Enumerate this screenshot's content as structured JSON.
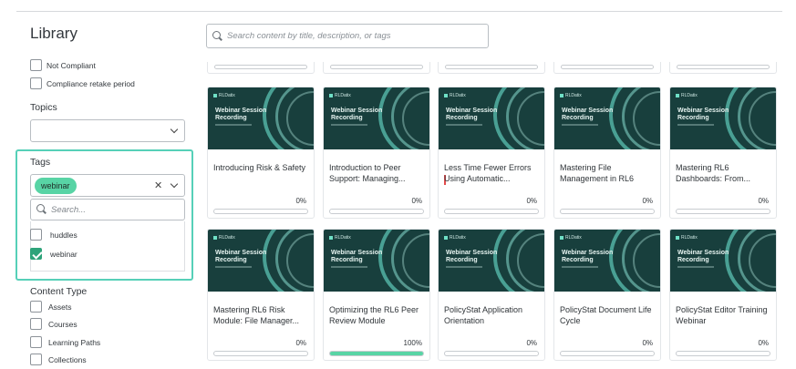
{
  "library": {
    "title": "Library"
  },
  "search": {
    "placeholder": "Search content by title, description, or tags"
  },
  "compliance": [
    {
      "label": "Not Compliant",
      "checked": false
    },
    {
      "label": "Compliance retake period",
      "checked": false
    }
  ],
  "topics": {
    "label": "Topics",
    "value": ""
  },
  "tags": {
    "label": "Tags",
    "selected_chip": "webinar",
    "search_placeholder": "Search...",
    "options": [
      {
        "label": "huddles",
        "checked": false
      },
      {
        "label": "webinar",
        "checked": true
      }
    ],
    "highlight_color": "#56d0b8"
  },
  "content_type": {
    "label": "Content Type",
    "options": [
      {
        "label": "Assets",
        "checked": false
      },
      {
        "label": "Courses",
        "checked": false
      },
      {
        "label": "Learning Paths",
        "checked": false
      },
      {
        "label": "Collections",
        "checked": false
      }
    ]
  },
  "thumbnail": {
    "brand": "RLDatix",
    "title": "Webinar Session Recording"
  },
  "cards": [
    {
      "title": "Introducing Risk & Safety",
      "progress_label": "0%",
      "progress": 0
    },
    {
      "title": "Introduction to Peer Support: Managing...",
      "progress_label": "0%",
      "progress": 0
    },
    {
      "title": "Less Time Fewer Errors Using Automatic...",
      "progress_label": "0%",
      "progress": 0
    },
    {
      "title": "Mastering File Management in RL6",
      "progress_label": "0%",
      "progress": 0
    },
    {
      "title": "Mastering RL6 Dashboards: From...",
      "progress_label": "0%",
      "progress": 0
    },
    {
      "title": "Mastering RL6 Risk Module: File Manager...",
      "progress_label": "0%",
      "progress": 0
    },
    {
      "title": "Optimizing the RL6 Peer Review Module",
      "progress_label": "100%",
      "progress": 100
    },
    {
      "title": "PolicyStat Application Orientation",
      "progress_label": "0%",
      "progress": 0
    },
    {
      "title": "PolicyStat Document Life Cycle",
      "progress_label": "0%",
      "progress": 0
    },
    {
      "title": "PolicyStat Editor Training Webinar",
      "progress_label": "0%",
      "progress": 0
    }
  ],
  "colors": {
    "accent": "#58d4a5",
    "thumbnail_bg": "#183f3d",
    "text": "#2b2f33"
  }
}
